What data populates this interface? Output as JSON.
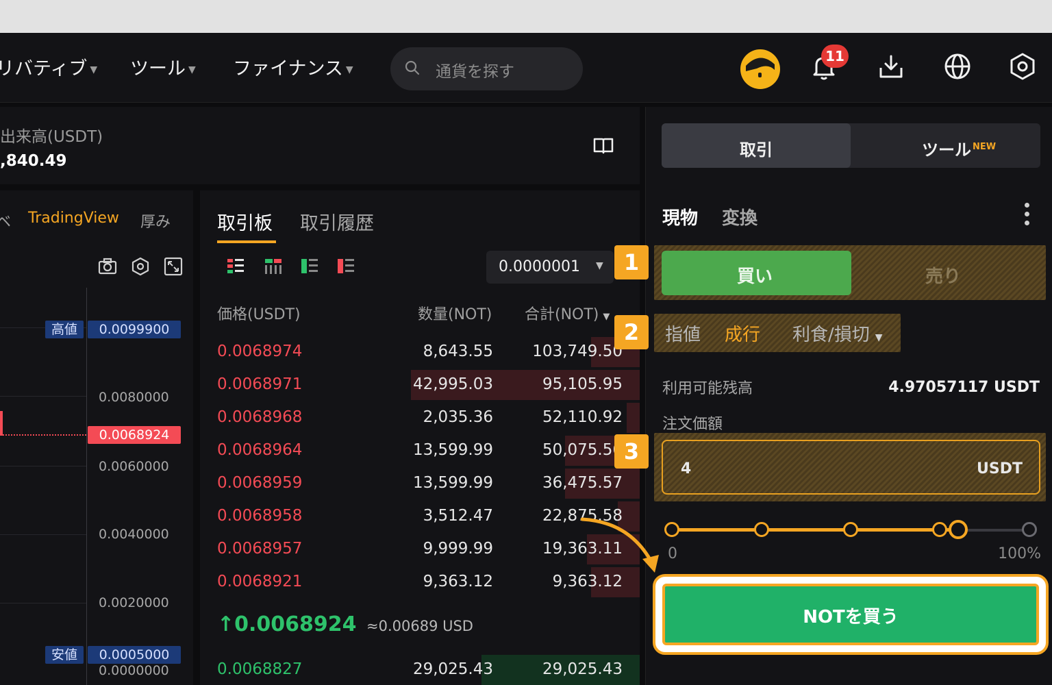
{
  "nav": {
    "items": [
      {
        "label": "リバティブ"
      },
      {
        "label": "ツール"
      },
      {
        "label": "ファイナンス"
      }
    ],
    "search_placeholder": "通貨を探す",
    "notification_count": "11"
  },
  "stats": {
    "volume_label": "出来高(USDT)",
    "volume_value": ",840.49"
  },
  "chart": {
    "tabs": [
      "ベ",
      "TradingView",
      "厚み"
    ],
    "high_label": "高値",
    "high_value": "0.0099900",
    "low_label": "安値",
    "low_value": "0.0005000",
    "current_value": "0.0068924",
    "axis": [
      "0.0080000",
      "0.0060000",
      "0.0040000",
      "0.0020000",
      "0.0000000"
    ]
  },
  "orderbook": {
    "tabs": [
      "取引板",
      "取引履歴"
    ],
    "precision": "0.0000001",
    "headers": {
      "price": "価格(USDT)",
      "qty": "数量(NOT)",
      "total": "合計(NOT)"
    },
    "asks": [
      {
        "price": "0.0068974",
        "qty": "8,643.55",
        "total": "103,749.50",
        "depth": 0.11
      },
      {
        "price": "0.0068971",
        "qty": "42,995.03",
        "total": "95,105.95",
        "depth": 0.52
      },
      {
        "price": "0.0068968",
        "qty": "2,035.36",
        "total": "52,110.92",
        "depth": 0.03
      },
      {
        "price": "0.0068964",
        "qty": "13,599.99",
        "total": "50,075.56",
        "depth": 0.17
      },
      {
        "price": "0.0068959",
        "qty": "13,599.99",
        "total": "36,475.57",
        "depth": 0.17
      },
      {
        "price": "0.0068958",
        "qty": "3,512.47",
        "total": "22,875.58",
        "depth": 0.05
      },
      {
        "price": "0.0068957",
        "qty": "9,999.99",
        "total": "19,363.11",
        "depth": 0.12
      },
      {
        "price": "0.0068921",
        "qty": "9,363.12",
        "total": "9,363.12",
        "depth": 0.11
      }
    ],
    "last_price": "↑0.0068924",
    "last_usd": "≈0.00689 USD",
    "bids": [
      {
        "price": "0.0068827",
        "qty": "29,025.43",
        "total": "29,025.43",
        "depth": 0.36
      }
    ]
  },
  "order": {
    "seg_trade": "取引",
    "seg_tools": "ツール",
    "seg_new": "NEW",
    "mode_spot": "現物",
    "mode_convert": "変換",
    "buy_label": "買い",
    "sell_label": "売り",
    "type_limit": "指値",
    "type_market": "成行",
    "type_tpsl": "利食/損切",
    "available_label": "利用可能残高",
    "available_value": "4.97057117 USDT",
    "price_label": "注文価額",
    "amount_value": "4",
    "amount_unit": "USDT",
    "slider_min": "0",
    "slider_max": "100%",
    "slider_value": 0.8,
    "submit_label": "NOTを買う"
  },
  "steps": [
    "1",
    "2",
    "3"
  ],
  "colors": {
    "accent": "#f5a623",
    "buy": "#20b168",
    "sell": "#f44b55"
  }
}
